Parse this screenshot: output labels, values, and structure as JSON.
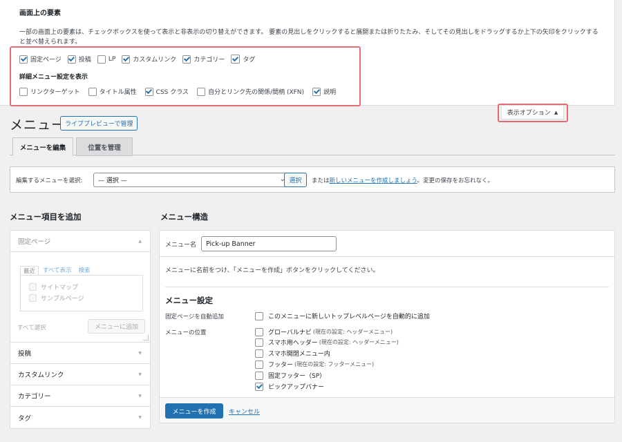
{
  "screen_options": {
    "title": "画面上の要素",
    "description": "一部の画面上の要素は、チェックボックスを使って表示と非表示の切り替えができます。 要素の見出しをクリックすると展開または折りたたみ、そしてその見出しをドラッグするか上下の矢印をクリックすると並べ替えられます。",
    "elements": [
      {
        "label": "固定ページ",
        "checked": true
      },
      {
        "label": "投稿",
        "checked": true
      },
      {
        "label": "LP",
        "checked": false
      },
      {
        "label": "カスタムリンク",
        "checked": true
      },
      {
        "label": "カテゴリー",
        "checked": true
      },
      {
        "label": "タグ",
        "checked": true
      }
    ],
    "advanced_title": "詳細メニュー設定を表示",
    "advanced": [
      {
        "label": "リンクターゲット",
        "checked": false
      },
      {
        "label": "タイトル属性",
        "checked": false
      },
      {
        "label": "CSS クラス",
        "checked": true
      },
      {
        "label": "自分とリンク先の関係/間柄 (XFN)",
        "checked": false
      },
      {
        "label": "説明",
        "checked": true
      }
    ],
    "toggle_label": "表示オプション",
    "toggle_arrow": "▲"
  },
  "page": {
    "title": "メニュー",
    "live_preview": "ライブプレビューで管理"
  },
  "tabs": {
    "edit": "メニューを編集",
    "locations": "位置を管理"
  },
  "select_bar": {
    "label": "編集するメニューを選択:",
    "selected": "— 選択 —",
    "button": "選択",
    "or_text": "または",
    "create_link": "新しいメニューを作成しましょう",
    "tail": "。変更の保存をお忘れなく。"
  },
  "add_items": {
    "title": "メニュー項目を追加",
    "open_section": "固定ページ",
    "inner_tabs": [
      "最近",
      "すべて表示",
      "検索"
    ],
    "pages": [
      "サイトマップ",
      "サンプルページ"
    ],
    "select_all": "すべて選択",
    "add_button": "メニューに追加",
    "sections": [
      "投稿",
      "カスタムリンク",
      "カテゴリー",
      "タグ"
    ]
  },
  "structure": {
    "title": "メニュー構造",
    "name_label": "メニュー名",
    "name_value": "Pick-up Banner",
    "note": "メニューに名前をつけ、「メニューを作成」ボタンをクリックしてください。",
    "settings_title": "メニュー設定",
    "auto_add_label": "固定ページを自動追加",
    "auto_add_option": "このメニューに新しいトップレベルページを自動的に追加",
    "location_label": "メニューの位置",
    "locations": [
      {
        "label": "グローバルナビ",
        "note": "(現在の設定: ヘッダーメニュー)",
        "checked": false
      },
      {
        "label": "スマホ用ヘッダー",
        "note": "(現在の設定: ヘッダーメニュー)",
        "checked": false
      },
      {
        "label": "スマホ開閉メニュー内",
        "note": "",
        "checked": false
      },
      {
        "label": "フッター",
        "note": "(現在の設定: フッターメニュー)",
        "checked": false
      },
      {
        "label": "固定フッター（SP）",
        "note": "",
        "checked": false
      },
      {
        "label": "ピックアップバナー",
        "note": "",
        "checked": true
      }
    ],
    "create_button": "メニューを作成",
    "cancel": "キャンセル"
  },
  "colors": {
    "accent": "#2271b1",
    "highlight": "#e66a75"
  }
}
